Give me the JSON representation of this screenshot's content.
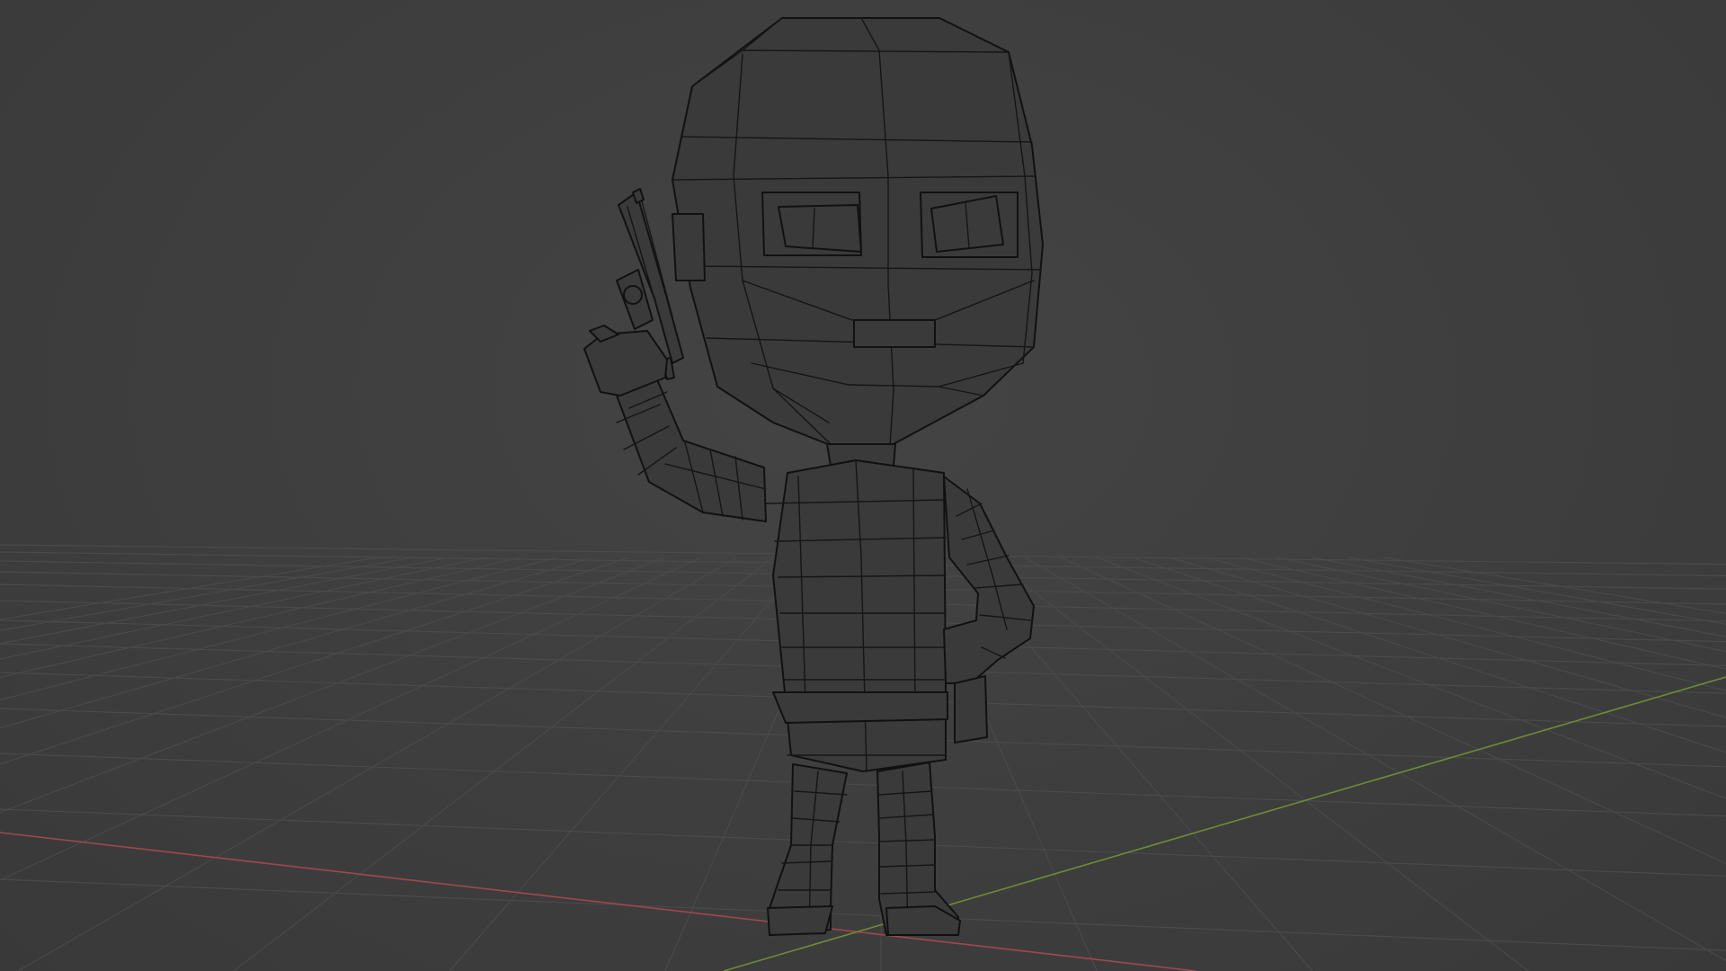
{
  "viewport": {
    "mode": "wireframe",
    "background_color": "#3d3d3d",
    "grid_color": "#4a4a4a",
    "x_axis_color": "#a0474c",
    "y_axis_color": "#6f8b32",
    "wire_color": "#111111"
  },
  "scene": {
    "object": "low-poly-character",
    "prop": "pistol"
  }
}
